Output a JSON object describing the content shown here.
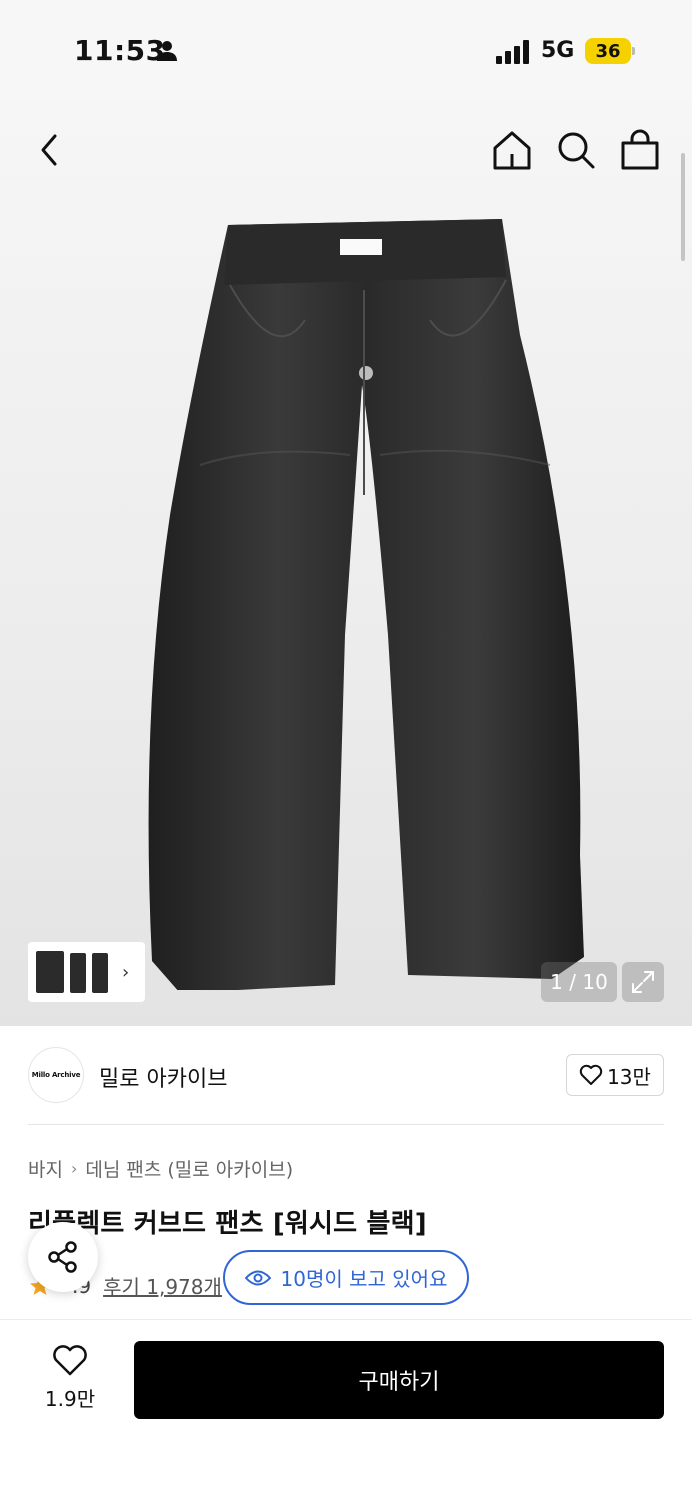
{
  "status_bar": {
    "time": "11:53",
    "network": "5G",
    "battery": "36",
    "icons": [
      "person-icon",
      "signal-icon"
    ]
  },
  "nav": {
    "icons": [
      "back-icon",
      "home-icon",
      "search-icon",
      "bag-icon"
    ]
  },
  "gallery": {
    "counter": "1 / 10",
    "icons": [
      "expand-icon",
      "chevron-right-icon"
    ]
  },
  "brand": {
    "logo_text": "Millo Archive",
    "name": "밀로 아카이브",
    "likes": "13만"
  },
  "breadcrumb": {
    "category": "바지",
    "subcategory": "데님 팬츠 (밀로 아카이브)"
  },
  "product": {
    "title": "리플렉트 커브드 팬츠 [워시드 블랙]"
  },
  "rating": {
    "value": ".9",
    "reviews": "후기 1,978개"
  },
  "viewers": {
    "text": "10명이 보고 있어요"
  },
  "bottom_bar": {
    "wish_count": "1.9만",
    "buy_label": "구매하기"
  },
  "colors": {
    "accent_blue": "#2f66d4",
    "battery_yellow": "#f5d100",
    "star": "#f5a623",
    "buy_bg": "#000000"
  }
}
